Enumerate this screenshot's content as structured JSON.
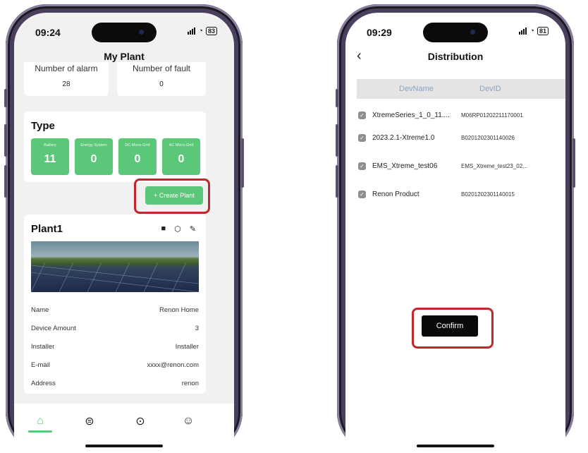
{
  "left_phone": {
    "time": "09:24",
    "battery": "83",
    "title": "My Plant",
    "alarm_label": "Number of alarm",
    "alarm_value": "28",
    "fault_label": "Number of fault",
    "fault_value": "0",
    "type_heading": "Type",
    "type_tiles": [
      {
        "label": "Battery",
        "value": "11"
      },
      {
        "label": "Energy System",
        "value": "0"
      },
      {
        "label": "DC Micro-Grid",
        "value": "0"
      },
      {
        "label": "AC Micro-Grid",
        "value": "0"
      }
    ],
    "create_plant_label": "+ Create Plant",
    "plant_name": "Plant1",
    "details": [
      {
        "label": "Name",
        "value": "Renon Home"
      },
      {
        "label": "Device Amount",
        "value": "3"
      },
      {
        "label": "Installer",
        "value": "Installer"
      },
      {
        "label": "E-mail",
        "value": "xxxx@renon.com"
      },
      {
        "label": "Address",
        "value": "renon"
      }
    ],
    "accent_color": "#5bc778"
  },
  "right_phone": {
    "time": "09:29",
    "battery": "81",
    "title": "Distribution",
    "col_name": "DevName",
    "col_id": "DevID",
    "devices": [
      {
        "name": "XtremeSeries_1_0_11....",
        "id": "M06RP01202211170001"
      },
      {
        "name": "2023.2.1-Xtreme1.0",
        "id": "B0201202301140026"
      },
      {
        "name": "EMS_Xtreme_test06",
        "id": "EMS_Xtreme_test23_02..."
      },
      {
        "name": "Renon Product",
        "id": "B0201202301140015"
      }
    ],
    "confirm_label": "Confirm"
  },
  "highlight_color": "#c0282c"
}
